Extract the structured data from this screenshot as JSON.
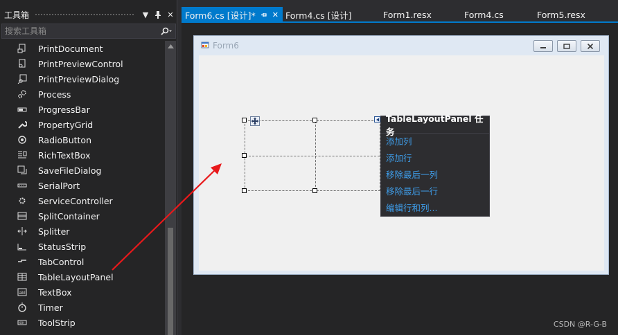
{
  "toolbox": {
    "title": "工具箱",
    "search_placeholder": "搜索工具箱",
    "items": [
      {
        "label": "PrintDocument",
        "icon": "print-document-icon"
      },
      {
        "label": "PrintPreviewControl",
        "icon": "print-preview-control-icon"
      },
      {
        "label": "PrintPreviewDialog",
        "icon": "print-preview-dialog-icon"
      },
      {
        "label": "Process",
        "icon": "process-icon"
      },
      {
        "label": "ProgressBar",
        "icon": "progressbar-icon"
      },
      {
        "label": "PropertyGrid",
        "icon": "propertygrid-icon"
      },
      {
        "label": "RadioButton",
        "icon": "radiobutton-icon"
      },
      {
        "label": "RichTextBox",
        "icon": "richtextbox-icon"
      },
      {
        "label": "SaveFileDialog",
        "icon": "savefiledialog-icon"
      },
      {
        "label": "SerialPort",
        "icon": "serialport-icon"
      },
      {
        "label": "ServiceController",
        "icon": "servicecontroller-icon"
      },
      {
        "label": "SplitContainer",
        "icon": "splitcontainer-icon"
      },
      {
        "label": "Splitter",
        "icon": "splitter-icon"
      },
      {
        "label": "StatusStrip",
        "icon": "statusstrip-icon"
      },
      {
        "label": "TabControl",
        "icon": "tabcontrol-icon"
      },
      {
        "label": "TableLayoutPanel",
        "icon": "tablelayoutpanel-icon"
      },
      {
        "label": "TextBox",
        "icon": "textbox-icon"
      },
      {
        "label": "Timer",
        "icon": "timer-icon"
      },
      {
        "label": "ToolStrip",
        "icon": "toolstrip-icon"
      }
    ]
  },
  "tabs": [
    {
      "label": "Form6.cs [设计]*",
      "active": true
    },
    {
      "label": "Form4.cs [设计]",
      "active": false
    },
    {
      "label": "Form1.resx",
      "active": false
    },
    {
      "label": "Form4.cs",
      "active": false
    },
    {
      "label": "Form5.resx",
      "active": false
    }
  ],
  "form": {
    "title": "Form6"
  },
  "smart_tag": {
    "header": "TableLayoutPanel 任务",
    "actions": [
      "添加列",
      "添加行",
      "移除最后一列",
      "移除最后一行",
      "编辑行和列..."
    ]
  },
  "watermark": "CSDN @R-G-B",
  "colors": {
    "accent": "#007acc",
    "link": "#3e9be6",
    "arrow": "#e8191b"
  }
}
